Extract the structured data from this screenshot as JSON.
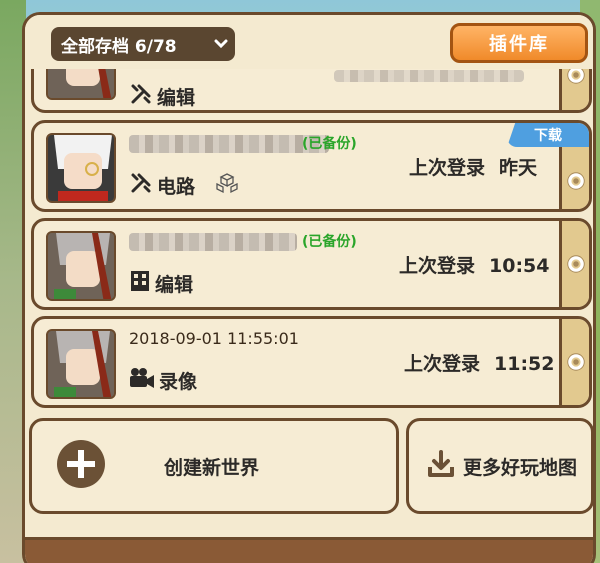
{
  "header": {
    "filter_label": "全部存档 6/78",
    "plugin_button_label": "插件库"
  },
  "saves": [
    {
      "mode": "编辑",
      "mode_icon": "wrench-icon",
      "title": ""
    },
    {
      "title_blurred": true,
      "backup": "(已备份)",
      "mode": "电路",
      "mode_icon": "wrench-icon",
      "extra_icon": "cubes-icon",
      "login_label": "上次登录",
      "login_time": "昨天",
      "badge": "下载"
    },
    {
      "title_blurred": true,
      "backup": "(已备份)",
      "mode": "编辑",
      "mode_icon": "building-icon",
      "login_label": "上次登录",
      "login_time": "10:54"
    },
    {
      "title": "2018-09-01 11:55:01",
      "mode": "录像",
      "mode_icon": "video-camera-icon",
      "login_label": "上次登录",
      "login_time": "11:52"
    }
  ],
  "actions": {
    "create_label": "创建新世界",
    "more_maps_label": "更多好玩地图"
  },
  "colors": {
    "panel_bg": "#f4ead0",
    "border": "#6a4a2c",
    "accent_orange": "#f08a2a",
    "badge_blue": "#4f9fe0",
    "backup_green": "#2aa52a"
  }
}
